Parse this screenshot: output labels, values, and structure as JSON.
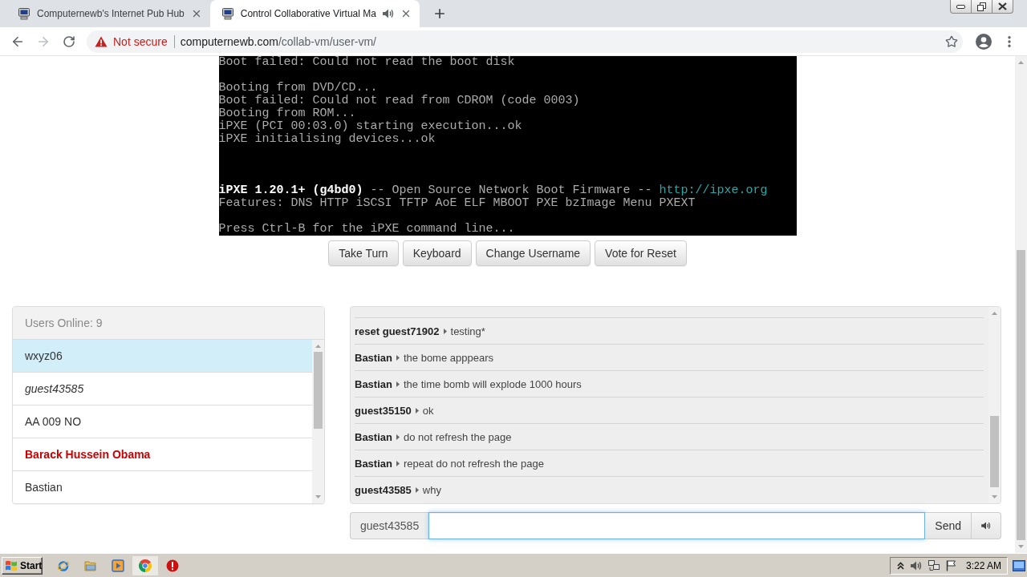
{
  "browser": {
    "tabs": [
      {
        "title": "Computernewb's Internet Pub Hub",
        "selected": false,
        "audio": false
      },
      {
        "title": "Control Collaborative Virtual Ma",
        "selected": true,
        "audio": true
      }
    ],
    "forward_enabled": false,
    "security_label": "Not secure",
    "url": {
      "host": "computernewb.com",
      "path": "/collab-vm/user-vm/"
    }
  },
  "vm_screen": {
    "lines": [
      {
        "kind": "text",
        "segments": [
          {
            "kind": "normal",
            "text": "Boot failed: Could not read the boot disk"
          }
        ]
      },
      {
        "kind": "blank"
      },
      {
        "kind": "text",
        "segments": [
          {
            "kind": "normal",
            "text": "Booting from DVD/CD..."
          }
        ]
      },
      {
        "kind": "text",
        "segments": [
          {
            "kind": "normal",
            "text": "Boot failed: Could not read from CDROM (code 0003)"
          }
        ]
      },
      {
        "kind": "text",
        "segments": [
          {
            "kind": "normal",
            "text": "Booting from ROM..."
          }
        ]
      },
      {
        "kind": "text",
        "segments": [
          {
            "kind": "normal",
            "text": "iPXE (PCI 00:03.0) starting execution...ok"
          }
        ]
      },
      {
        "kind": "text",
        "segments": [
          {
            "kind": "normal",
            "text": "iPXE initialising devices...ok"
          }
        ]
      },
      {
        "kind": "blank"
      },
      {
        "kind": "blank"
      },
      {
        "kind": "blank"
      },
      {
        "kind": "text",
        "segments": [
          {
            "kind": "bright",
            "text": "iPXE 1.20.1+ (g4bd0)"
          },
          {
            "kind": "normal",
            "text": " -- Open Source Network Boot Firmware -- "
          },
          {
            "kind": "url",
            "text": "http://ipxe.org"
          }
        ]
      },
      {
        "kind": "text",
        "segments": [
          {
            "kind": "normal",
            "text": "Features: DNS HTTP iSCSI TFTP AoE ELF MBOOT PXE bzImage Menu PXEXT"
          }
        ]
      },
      {
        "kind": "blank"
      },
      {
        "kind": "text",
        "segments": [
          {
            "kind": "normal",
            "text": "Press Ctrl-B for the iPXE command line..."
          }
        ]
      }
    ]
  },
  "vm_buttons": [
    "Take Turn",
    "Keyboard",
    "Change Username",
    "Vote for Reset"
  ],
  "users": {
    "header": "Users Online: 9",
    "items": [
      {
        "name": "wxyz06",
        "kind": "user",
        "has_turn": true
      },
      {
        "name": "guest43585",
        "kind": "self",
        "has_turn": false
      },
      {
        "name": "AA 009 NO",
        "kind": "user",
        "has_turn": false
      },
      {
        "name": "Barack Hussein Obama",
        "kind": "admin",
        "has_turn": false
      },
      {
        "name": "Bastian",
        "kind": "user",
        "has_turn": false
      }
    ]
  },
  "chat": {
    "messages": [
      {
        "user": "reset guest71902",
        "text": "testing*"
      },
      {
        "user": "Bastian",
        "text": "the bome apppears"
      },
      {
        "user": "Bastian",
        "text": "the time bomb will explode 1000 hours"
      },
      {
        "user": "guest35150",
        "text": "ok"
      },
      {
        "user": "Bastian",
        "text": "do not refresh the page"
      },
      {
        "user": "Bastian",
        "text": "repeat do not refresh the page"
      },
      {
        "user": "guest43585",
        "text": "why"
      }
    ],
    "username": "guest43585",
    "send_label": "Send"
  },
  "taskbar": {
    "start_label": "Start",
    "apps": [
      {
        "kind": "orbit",
        "active": false
      },
      {
        "kind": "folder",
        "active": false
      },
      {
        "kind": "play",
        "active": false
      },
      {
        "kind": "wheel",
        "active": true
      },
      {
        "kind": "alert",
        "active": false
      }
    ],
    "clock": "3:22 AM"
  }
}
